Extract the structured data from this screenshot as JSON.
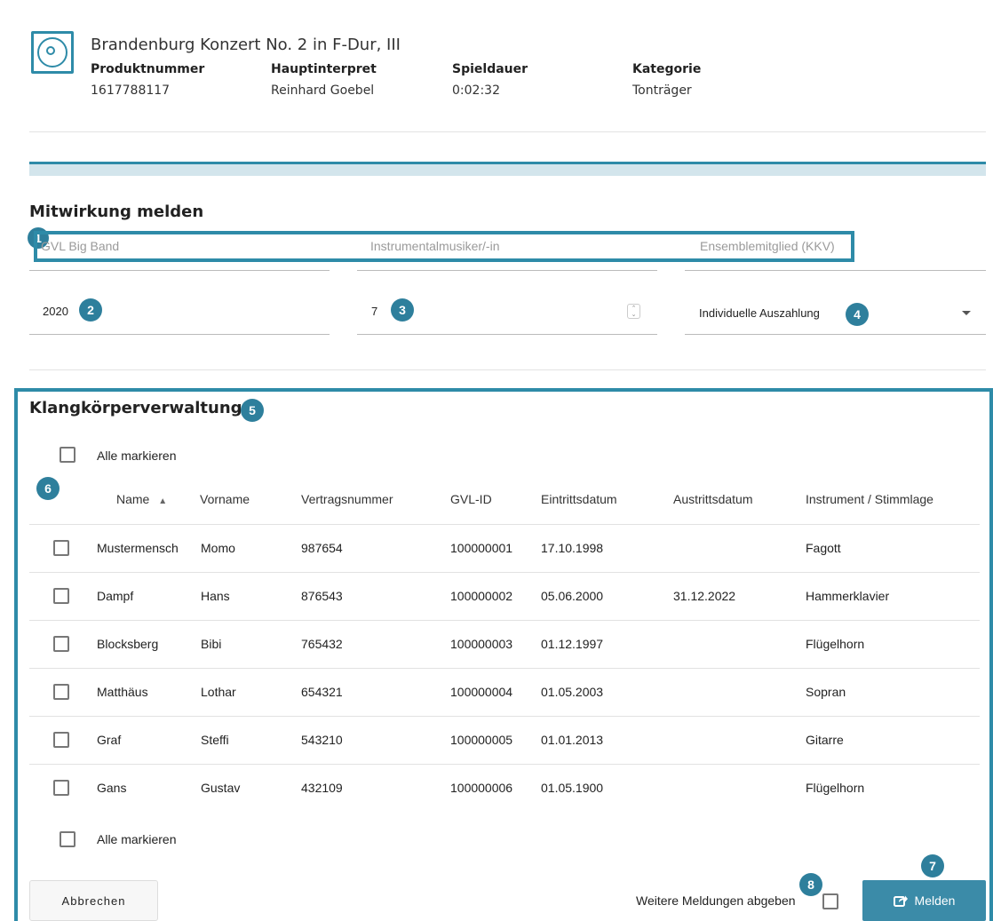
{
  "product": {
    "title": "Brandenburg Konzert No. 2 in F-Dur, III",
    "fields": [
      {
        "label": "Produktnummer",
        "value": "1617788117"
      },
      {
        "label": "Hauptinterpret",
        "value": "Reinhard Goebel"
      },
      {
        "label": "Spieldauer",
        "value": "0:02:32"
      },
      {
        "label": "Kategorie",
        "value": "Tonträger"
      }
    ]
  },
  "form": {
    "section_title": "Mitwirkung melden",
    "disabled": {
      "ensemble": "GVL Big Band",
      "role": "Instrumentalmusiker/-in",
      "membership": "Ensemblemitglied (KKV)"
    },
    "year": "2020",
    "count": "7",
    "payout": "Individuelle Auszahlung"
  },
  "table": {
    "section_title": "Klangkörperverwaltung",
    "select_all_label": "Alle markieren",
    "columns": [
      "Name",
      "Vorname",
      "Vertragsnummer",
      "GVL-ID",
      "Eintrittsdatum",
      "Austrittsdatum",
      "Instrument / Stimmlage"
    ],
    "sort_indicator": "▲",
    "rows": [
      {
        "name": "Mustermensch",
        "vorname": "Momo",
        "vertrag": "987654",
        "gvlid": "100000001",
        "eintritt": "17.10.1998",
        "austritt": "",
        "instrument": "Fagott"
      },
      {
        "name": "Dampf",
        "vorname": "Hans",
        "vertrag": "876543",
        "gvlid": "100000002",
        "eintritt": "05.06.2000",
        "austritt": "31.12.2022",
        "instrument": "Hammerklavier"
      },
      {
        "name": "Blocksberg",
        "vorname": "Bibi",
        "vertrag": "765432",
        "gvlid": "100000003",
        "eintritt": "01.12.1997",
        "austritt": "",
        "instrument": "Flügelhorn"
      },
      {
        "name": "Matthäus",
        "vorname": "Lothar",
        "vertrag": "654321",
        "gvlid": "100000004",
        "eintritt": "01.05.2003",
        "austritt": "",
        "instrument": "Sopran"
      },
      {
        "name": "Graf",
        "vorname": "Steffi",
        "vertrag": "543210",
        "gvlid": "100000005",
        "eintritt": "01.01.2013",
        "austritt": "",
        "instrument": "Gitarre"
      },
      {
        "name": "Gans",
        "vorname": "Gustav",
        "vertrag": "432109",
        "gvlid": "100000006",
        "eintritt": "01.05.1900",
        "austritt": "",
        "instrument": "Flügelhorn"
      }
    ]
  },
  "footer": {
    "cancel": "Abbrechen",
    "more_label": "Weitere Meldungen abgeben",
    "submit": "Melden"
  },
  "badges": [
    "1",
    "2",
    "3",
    "4",
    "5",
    "6",
    "7",
    "8"
  ],
  "colors": {
    "accent": "#2e8ba8",
    "badge": "#2e7f9c",
    "button": "#3b8ba8"
  },
  "icons": {
    "product": "vinyl-record-icon",
    "submit": "share-icon",
    "sort": "sort-ascending-icon",
    "dropdown": "chevron-down-icon",
    "spinner": "number-spinner-icon"
  }
}
